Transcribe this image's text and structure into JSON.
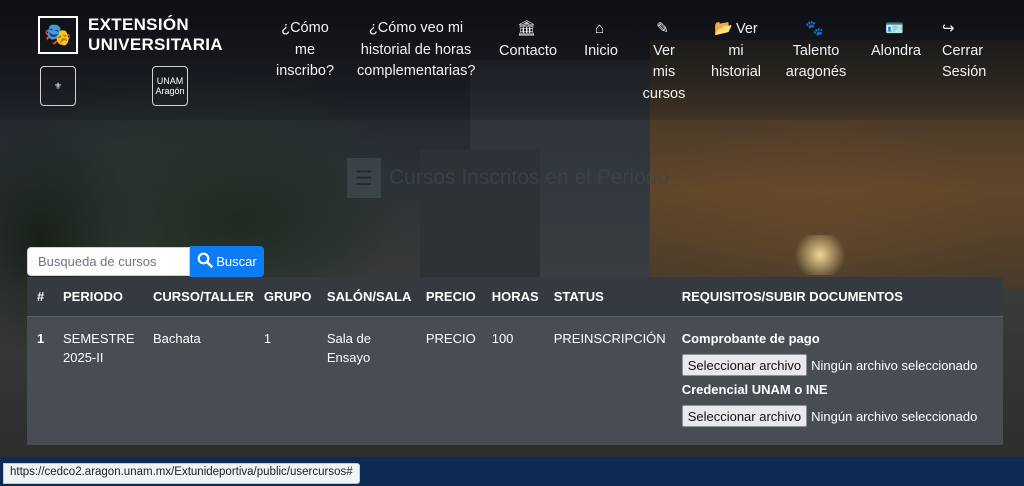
{
  "brand": {
    "line1": "EXTENSIÓN",
    "line2": "UNIVERSITARIA",
    "aragon_label": "Aragón",
    "unam_label": "UNAM"
  },
  "nav": [
    {
      "id": "inscribo",
      "icon": "",
      "label": [
        "¿Cómo",
        "me",
        "inscribo?"
      ]
    },
    {
      "id": "historial-horas",
      "icon": "",
      "label": [
        "¿Cómo veo mi",
        "historial de horas",
        "complementarias?"
      ]
    },
    {
      "id": "contacto",
      "icon": "🏛",
      "label": [
        "Contacto"
      ]
    },
    {
      "id": "inicio",
      "icon": "⌂",
      "label": [
        "Inicio"
      ]
    },
    {
      "id": "ver-cursos",
      "icon": "✎",
      "label": [
        "Ver",
        "mis",
        "cursos"
      ]
    },
    {
      "id": "ver-historial",
      "icon": "📂",
      "label": [
        "Ver",
        "mi",
        "historial"
      ]
    },
    {
      "id": "talento",
      "icon": "🐾",
      "label": [
        "Talento",
        "aragonés"
      ]
    },
    {
      "id": "alondra",
      "icon": "🪪",
      "label": [
        "Alondra"
      ]
    },
    {
      "id": "cerrar",
      "icon": "↪",
      "label": [
        "Cerrar",
        "Sesión"
      ]
    }
  ],
  "page_title": "Cursos Inscritos en el Periodo",
  "search": {
    "placeholder": "Busqueda de cursos",
    "button_label": "Buscar"
  },
  "table": {
    "headers": [
      "#",
      "PERIODO",
      "CURSO/TALLER",
      "GRUPO",
      "SALÓN/SALA",
      "PRECIO",
      "HORAS",
      "STATUS",
      "REQUISITOS/SUBIR DOCUMENTOS"
    ],
    "rows": [
      {
        "num": "1",
        "periodo": "SEMESTRE 2025-II",
        "curso": "Bachata",
        "grupo": "1",
        "salon": "Sala de Ensayo",
        "precio": "PRECIO",
        "horas": "100",
        "status": "PREINSCRIPCIÓN",
        "requisitos": [
          {
            "label": "Comprobante de pago",
            "button": "Seleccionar archivo",
            "status": "Ningún archivo seleccionado"
          },
          {
            "label": "Credencial UNAM o INE",
            "button": "Seleccionar archivo",
            "status": "Ningún archivo seleccionado"
          }
        ]
      }
    ]
  },
  "status_url": "https://cedco2.aragon.unam.mx/Extunideportiva/public/usercursos#",
  "colors": {
    "search_button": "#0d7bf5",
    "table_header": "#343a40",
    "table_row": "#474d53",
    "footer": "#0d2a55"
  }
}
